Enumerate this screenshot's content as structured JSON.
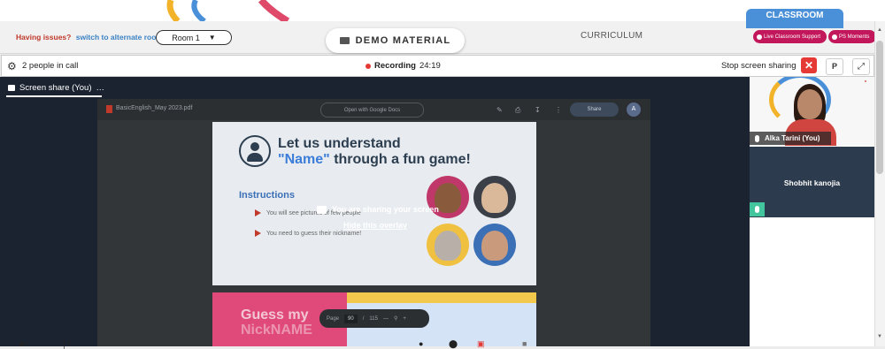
{
  "header": {
    "issues_text": "Having issues?",
    "issues_link": "switch to alternate room",
    "room_select": "Room 1",
    "demo_material": "DEMO MATERIAL",
    "curriculum": "CURRICULUM",
    "classroom_tab": "CLASSROOM",
    "live_support": "Live Classroom Support",
    "ps_moments": "PS Moments"
  },
  "call_bar": {
    "people": "2 people in call",
    "recording_label": "Recording",
    "recording_time": "24:19",
    "stop_sharing": "Stop screen sharing",
    "p_button": "P"
  },
  "stage": {
    "tab_label": "Screen share (You)",
    "more": "…",
    "pdf_name": "BasicEnglish_May 2023.pdf",
    "open_docs": "Open with Google Docs",
    "share": "Share",
    "avatar_letter": "A",
    "slide_heading_1": "Let us understand",
    "slide_heading_2_quote": "\"Name\"",
    "slide_heading_2_rest": " through a fun game!",
    "instructions": "Instructions",
    "bullet_1": "You will see pictures of few people",
    "bullet_2": "You need to guess their nickname!",
    "slide2_line1": "Guess my",
    "slide2_line2": "NickNAME",
    "overlay_title": "You are sharing your screen",
    "overlay_link": "Hide this overlay",
    "page_label": "Page",
    "page_current": "90",
    "page_sep": "/",
    "page_total": "115"
  },
  "participants": [
    {
      "name": "Alka Tarini (You)"
    },
    {
      "name": "Shobhit kanojia"
    }
  ],
  "colors": {
    "accent_red": "#e53935",
    "brand_pink": "#c2185b",
    "classroom_blue": "#4a90d9",
    "stage_bg": "#1b2330",
    "mic_green": "#43c59e"
  }
}
